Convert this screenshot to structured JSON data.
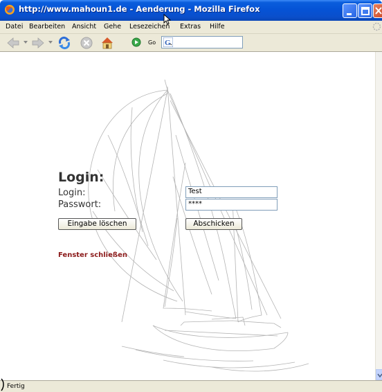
{
  "window": {
    "title": "http://www.mahoun1.de - Aenderung - Mozilla Firefox"
  },
  "menu": [
    {
      "label": "Datei",
      "name": "menu-datei"
    },
    {
      "label": "Bearbeiten",
      "name": "menu-bearbeiten"
    },
    {
      "label": "Ansicht",
      "name": "menu-ansicht"
    },
    {
      "label": "Gehe",
      "name": "menu-gehe"
    },
    {
      "label": "Lesezeichen",
      "name": "menu-lesezeichen"
    },
    {
      "label": "Extras",
      "name": "menu-extras"
    },
    {
      "label": "Hilfe",
      "name": "menu-hilfe"
    }
  ],
  "toolbar": {
    "go_label": "Go",
    "icons": [
      "back-arrow-icon",
      "forward-arrow-icon",
      "reload-icon",
      "stop-icon",
      "home-icon",
      "go-icon",
      "google-search-icon"
    ]
  },
  "form": {
    "heading": "Login:",
    "login_label": "Login:",
    "login_value": "Test",
    "password_label": "Passwort:",
    "password_value": "****",
    "reset_label": "Eingabe löschen",
    "submit_label": "Abschicken",
    "close_link": "Fenster schließen"
  },
  "status": {
    "text": "Fertig"
  },
  "colors": {
    "titlebar": "#0553d6",
    "chrome": "#ece9d8",
    "link": "#8b1a1a",
    "text": "#333333"
  }
}
